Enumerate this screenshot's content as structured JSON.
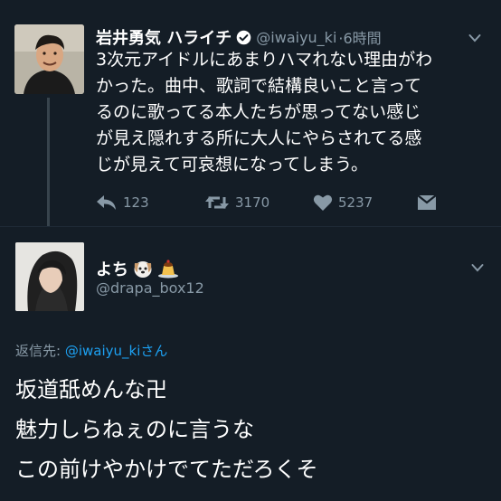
{
  "tweet": {
    "author_name": "岩井勇気 ハライチ",
    "author_handle": "@iwaiyu_ki",
    "time": "·6時間",
    "text_lines": [
      "3次元アイドルにあまりハマれない理由がわ",
      "かった。曲中、歌詞で結構良いこと言って",
      "るのに歌ってる本人たちが思ってない感じ",
      "が見え隠れする所に大人にやらされてる感",
      "じが見えて可哀想になってしまう。"
    ],
    "actions": {
      "reply_count": "123",
      "retweet_count": "3170",
      "like_count": "5237"
    }
  },
  "reply": {
    "author_name": "よち",
    "author_handle": "@drapa_box12",
    "reply_to_label": "返信先:",
    "reply_to_handle": "@iwaiyu_ki",
    "reply_to_suffix": "さん",
    "text_lines": [
      "坂道舐めんな卍",
      "魅力しらねぇのに言うな",
      "この前けやかけでてただろくそ"
    ]
  },
  "icons": {
    "verified": "verified-badge-icon",
    "reply": "reply-arrow-icon",
    "retweet": "retweet-icon",
    "like": "heart-icon",
    "dm": "direct-message-icon",
    "menu": "chevron-down-icon",
    "emoji_1": "dog-face-emoji",
    "emoji_2": "pudding-emoji"
  },
  "colors": {
    "background": "#141d26",
    "text": "#ffffff",
    "secondary": "#8899a6",
    "link": "#1da1f2"
  }
}
